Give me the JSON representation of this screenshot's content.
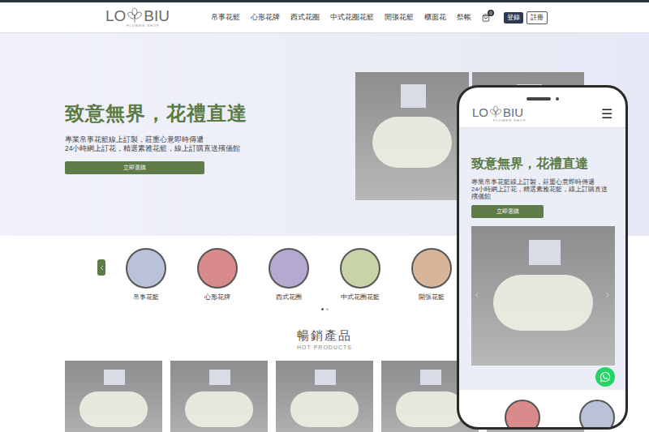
{
  "header": {
    "logo": {
      "left": "LO",
      "right": "BIU",
      "tagline": "FLOWER SHOP"
    },
    "nav": [
      "帛事花籃",
      "心形花牌",
      "西式花圈",
      "中式花圈花籃",
      "開張花籃",
      "櫃面花",
      "祭帳"
    ],
    "cart_count": "0",
    "login": "登錄",
    "register": "註冊"
  },
  "hero": {
    "title": "致意無界，花禮直達",
    "lines": [
      "專業帛事花籃線上訂製，莊重心意即時傳遞",
      "24小時網上訂花，精選素雅花籃，線上訂購直送殯儀館"
    ],
    "button": "立即選購"
  },
  "categories": {
    "items": [
      {
        "label": "帛事花籃"
      },
      {
        "label": "心形花牌"
      },
      {
        "label": "西式花圈"
      },
      {
        "label": "中式花圈花籃"
      },
      {
        "label": "開張花籃"
      }
    ],
    "dots": [
      {
        "selected": true
      },
      {
        "selected": false
      }
    ]
  },
  "hot_products": {
    "title": "暢銷產品",
    "subtitle": "HOT PRODUCTS"
  },
  "phone": {
    "logo": {
      "left": "LO",
      "right": "BIU",
      "tagline": "FLOWER SHOP"
    },
    "menu": "☰",
    "title": "致意無界，花禮直達",
    "lines": [
      "專業帛事花籃線上訂製，莊重心意即時傳遞",
      "24小時網上訂花，精選素雅花籃，線上訂購直送殯儀館"
    ],
    "button": "立即選購"
  }
}
